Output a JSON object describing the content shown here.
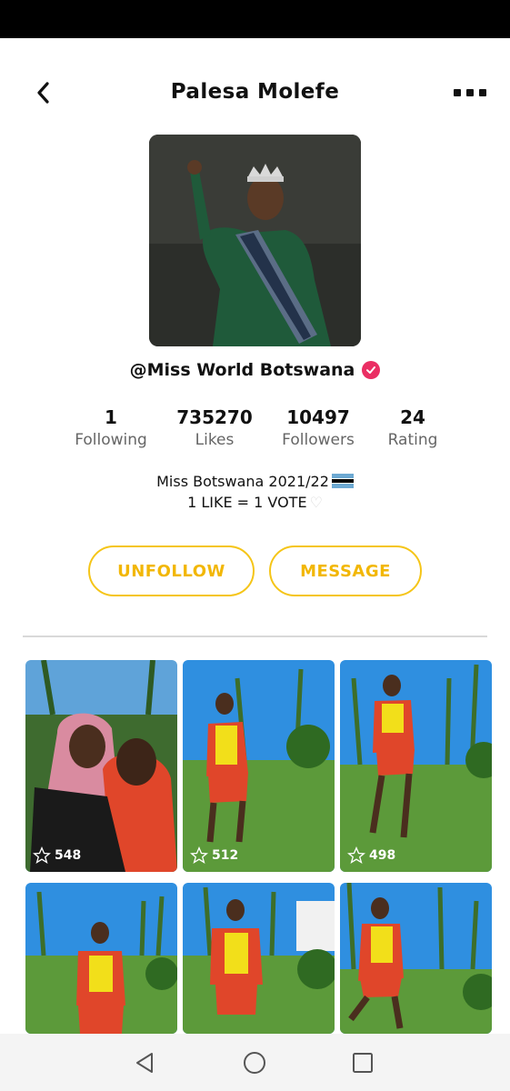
{
  "header": {
    "title": "Palesa Molefe",
    "back_icon": "chevron-left-icon",
    "more_icon": "more-horizontal-icon"
  },
  "profile": {
    "handle": "@Miss World Botswana",
    "verified": true,
    "verified_color": "#ea2e63",
    "bio_line1": "Miss Botswana 2021/22",
    "bio_line2": "1 LIKE = 1 VOTE"
  },
  "stats": [
    {
      "value": "1",
      "label": "Following"
    },
    {
      "value": "735270",
      "label": "Likes"
    },
    {
      "value": "10497",
      "label": "Followers"
    },
    {
      "value": "24",
      "label": "Rating"
    }
  ],
  "actions": {
    "unfollow_label": "UNFOLLOW",
    "message_label": "MESSAGE",
    "accent_color": "#f5c518"
  },
  "posts": [
    {
      "likes": "548"
    },
    {
      "likes": "512"
    },
    {
      "likes": "498"
    },
    {
      "likes": ""
    },
    {
      "likes": ""
    },
    {
      "likes": ""
    }
  ],
  "nav": {
    "back_icon": "triangle-back-icon",
    "home_icon": "circle-home-icon",
    "recents_icon": "square-recents-icon"
  }
}
